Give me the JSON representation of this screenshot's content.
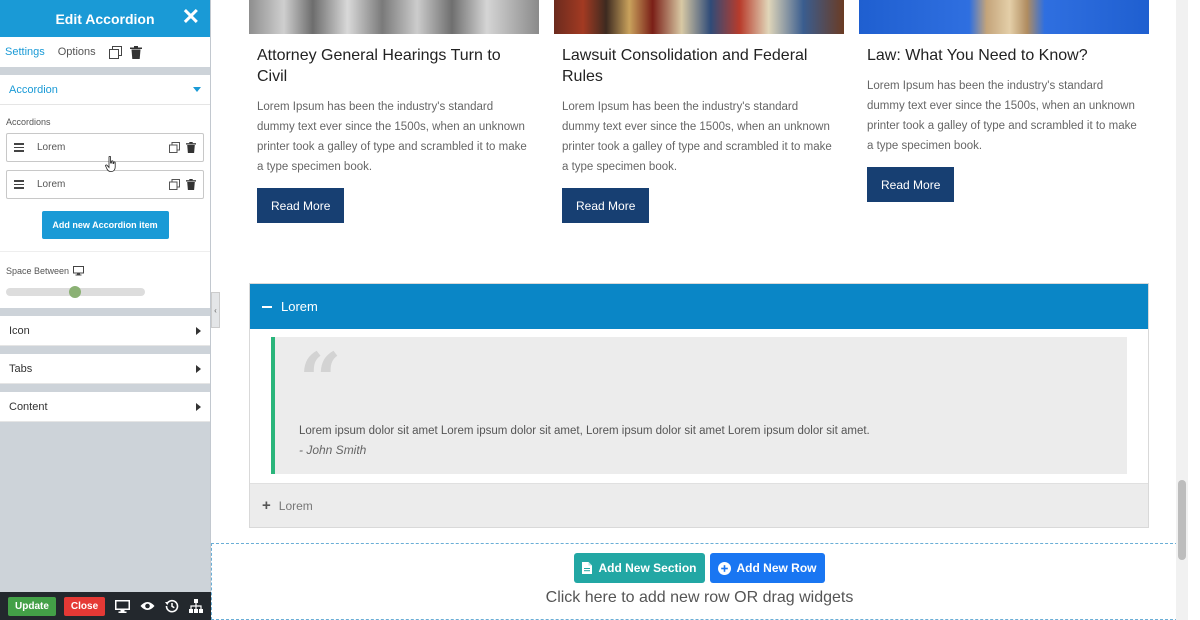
{
  "sidebar": {
    "title": "Edit Accordion",
    "tabs": {
      "settings": "Settings",
      "options": "Options"
    },
    "sections": {
      "accordion": "Accordion",
      "icon": "Icon",
      "tabs": "Tabs",
      "content": "Content"
    },
    "accordions_label": "Accordions",
    "items": [
      {
        "label": "Lorem"
      },
      {
        "label": "Lorem"
      }
    ],
    "add_item_label": "Add new Accordion item",
    "space_between_label": "Space Between",
    "footer": {
      "update": "Update",
      "close": "Close"
    }
  },
  "cards": [
    {
      "title": "Attorney General Hearings Turn to Civil",
      "text": "Lorem Ipsum has been the industry's standard dummy text ever since the 1500s, when an unknown printer took a galley of type and scrambled it to make a type specimen book.",
      "button": "Read More"
    },
    {
      "title": "Lawsuit Consolidation and Federal Rules",
      "text": "Lorem Ipsum has been the industry's standard dummy text ever since the 1500s, when an unknown printer took a galley of type and scrambled it to make a type specimen book.",
      "button": "Read More"
    },
    {
      "title": "Law: What You Need to Know?",
      "text": "Lorem Ipsum has been the industry's standard dummy text ever since the 1500s, when an unknown printer took a galley of type and scrambled it to make a type specimen book.",
      "button": "Read More"
    }
  ],
  "accordion": {
    "active_title": "Lorem",
    "quote_text": "Lorem ipsum dolor sit amet Lorem ipsum dolor sit amet, Lorem ipsum dolor sit amet Lorem ipsum dolor sit amet.",
    "quote_author": "- John Smith",
    "second_title": "Lorem"
  },
  "drop_zone": {
    "add_section": "Add New Section",
    "add_row": "Add New Row",
    "hint": "Click here to add new row OR drag widgets"
  },
  "colors": {
    "accent": "#1a9ad6",
    "accordion_active": "#0a86c6",
    "read_more": "#173f72",
    "quote_border": "#2ab57b",
    "update": "#43a047",
    "close": "#e53935"
  }
}
